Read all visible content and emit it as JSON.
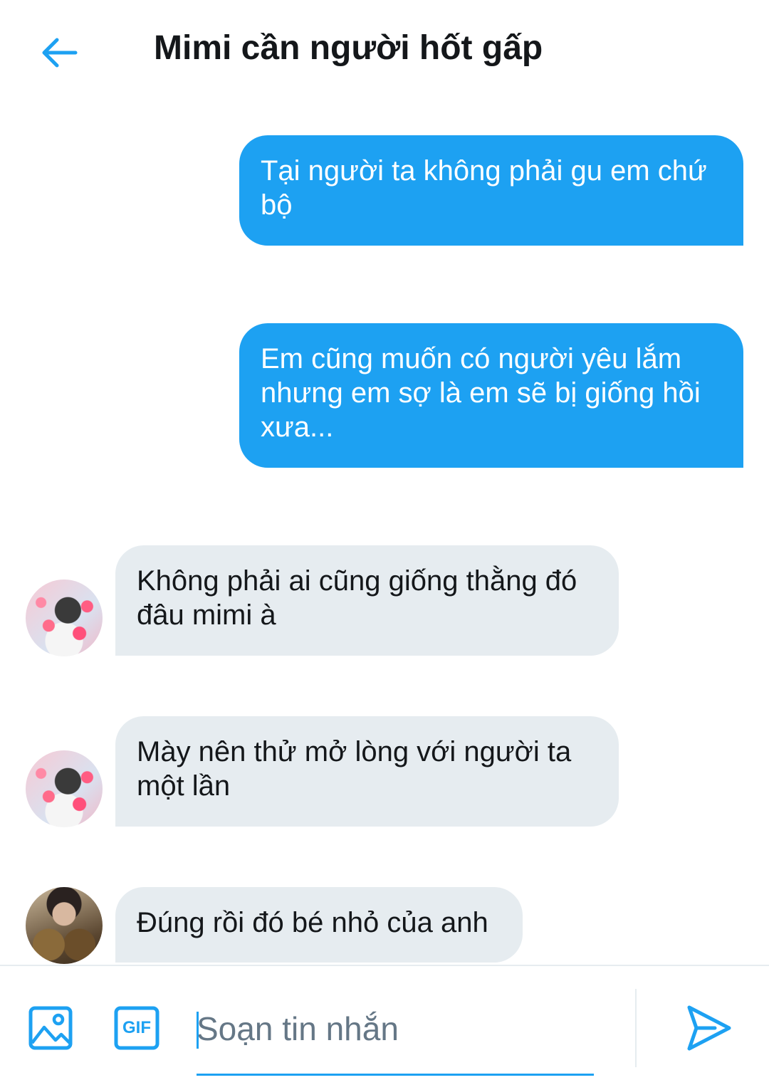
{
  "header": {
    "title": "Mimi cần người hốt gấp",
    "back_icon": "arrow-left-icon"
  },
  "colors": {
    "accent": "#1da1f2",
    "outgoing_bubble": "#1da1f2",
    "incoming_bubble": "#e6ecf0",
    "text_primary": "#14171a",
    "text_secondary": "#657786"
  },
  "messages": [
    {
      "direction": "outgoing",
      "text": "Tại người ta không phải gu em chứ bộ"
    },
    {
      "direction": "outgoing",
      "text": "Em cũng muốn có người yêu lắm nhưng em sợ là em sẽ bị giống hồi xưa..."
    },
    {
      "direction": "incoming",
      "text": "Không phải ai cũng giống thằng đó đâu mimi à"
    },
    {
      "direction": "incoming",
      "text": "Mày nên thử mở lòng với người ta một lần"
    },
    {
      "direction": "incoming",
      "text": "Đúng rồi đó bé nhỏ của anh"
    }
  ],
  "composer": {
    "placeholder": "Soạn tin nhắn",
    "image_icon": "image-icon",
    "gif_label": "GIF",
    "send_icon": "send-icon"
  }
}
